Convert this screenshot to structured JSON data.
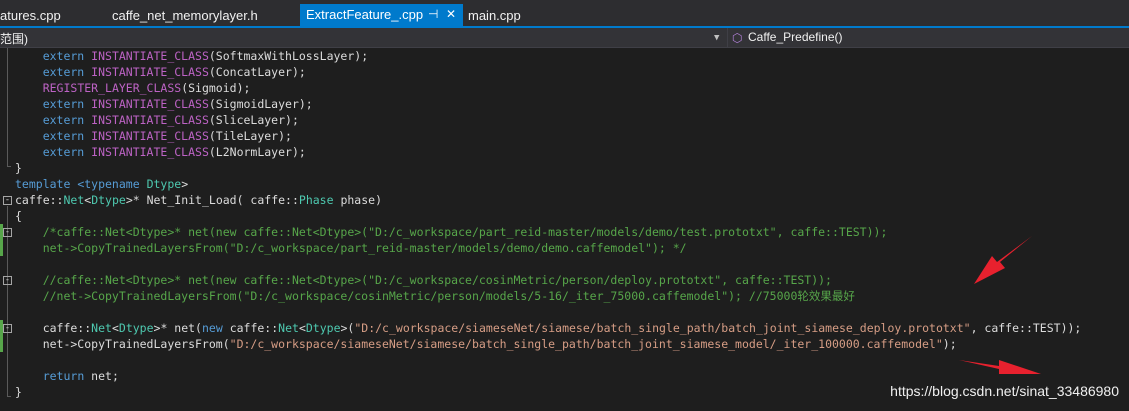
{
  "tabs": [
    {
      "label": "atures.cpp",
      "active": false
    },
    {
      "label": "caffe_net_memorylayer.h",
      "active": false
    },
    {
      "label": "ExtractFeature_.cpp",
      "active": true,
      "pin_icon": "pin-icon",
      "close_icon": "close-icon"
    },
    {
      "label": "main.cpp",
      "active": false
    }
  ],
  "navbar": {
    "scope_label": "范围)",
    "member_label": "Caffe_Predefine()",
    "member_icon": "cube-icon"
  },
  "code": {
    "line_1": {
      "t1": "    extern ",
      "t2": "INSTANTIATE_CLASS",
      "t3": "(SoftmaxWithLossLayer);"
    },
    "line_2": {
      "t1": "    extern ",
      "t2": "INSTANTIATE_CLASS",
      "t3": "(ConcatLayer);"
    },
    "line_3": {
      "t1": "    ",
      "t2": "REGISTER_LAYER_CLASS",
      "t3": "(Sigmoid);"
    },
    "line_4": {
      "t1": "    extern ",
      "t2": "INSTANTIATE_CLASS",
      "t3": "(SigmoidLayer);"
    },
    "line_5": {
      "t1": "    extern ",
      "t2": "INSTANTIATE_CLASS",
      "t3": "(SliceLayer);"
    },
    "line_6": {
      "t1": "    extern ",
      "t2": "INSTANTIATE_CLASS",
      "t3": "(TileLayer);"
    },
    "line_7": {
      "t1": "    extern ",
      "t2": "INSTANTIATE_CLASS",
      "t3": "(L2NormLayer);"
    },
    "line_8": {
      "t1": "}"
    },
    "line_9": {
      "t1": "template ",
      "t2": "<typename ",
      "t3": "Dtype",
      "t4": ">"
    },
    "line_10": {
      "t1": "caffe::",
      "t2": "Net",
      "t3": "<",
      "t4": "Dtype",
      "t5": ">* Net_Init_Load( caffe::",
      "t6": "Phase",
      "t7": " phase)"
    },
    "line_11": {
      "t1": "{"
    },
    "line_12": {
      "t1": "    /*caffe::Net<Dtype>* net(new caffe::Net<Dtype>(\"D:/c_workspace/part_reid-master/models/demo/test.prototxt\", caffe::TEST));"
    },
    "line_13": {
      "t1": "    net->CopyTrainedLayersFrom(\"D:/c_workspace/part_reid-master/models/demo/demo.caffemodel\"); */"
    },
    "line_14": {
      "t1": ""
    },
    "line_15": {
      "t1": "    //caffe::Net<Dtype>* net(new caffe::Net<Dtype>(\"D:/c_workspace/cosinMetric/person/deploy.prototxt\", caffe::TEST));"
    },
    "line_16": {
      "t1": "    //net->CopyTrainedLayersFrom(\"D:/c_workspace/cosinMetric/person/models/5-16/_iter_75000.caffemodel\"); //75000轮效果最好"
    },
    "line_17": {
      "t1": ""
    },
    "line_18": {
      "t1": "    caffe::",
      "t2": "Net",
      "t3": "<",
      "t4": "Dtype",
      "t5": ">* net(",
      "t6": "new ",
      "t7": "caffe::",
      "t8": "Net",
      "t9": "<",
      "t10": "Dtype",
      "t11": ">(",
      "t12": "\"D:/c_workspace/siameseNet/siamese/batch_single_path/batch_joint_siamese_deploy.prototxt\"",
      "t13": ", caffe::TEST));"
    },
    "line_19": {
      "t1": "    net->CopyTrainedLayersFrom(",
      "t2": "\"D:/c_workspace/siameseNet/siamese/batch_single_path/batch_joint_siamese_model/_iter_100000.caffemodel\"",
      "t3": ");"
    },
    "line_20": {
      "t1": ""
    },
    "line_21": {
      "t1": "    ",
      "t2": "return ",
      "t3": "net;"
    },
    "line_22": {
      "t1": "}"
    }
  },
  "fold_icon_label": "-",
  "watermark": "https://blog.csdn.net/sinat_33486980",
  "colors": {
    "keyword": "#569cd6",
    "macro": "#bd63c5",
    "type": "#4ec9b0",
    "string": "#d69d85",
    "comment": "#57a64a",
    "tab_active": "#007acc",
    "arrow": "#e8212e"
  }
}
